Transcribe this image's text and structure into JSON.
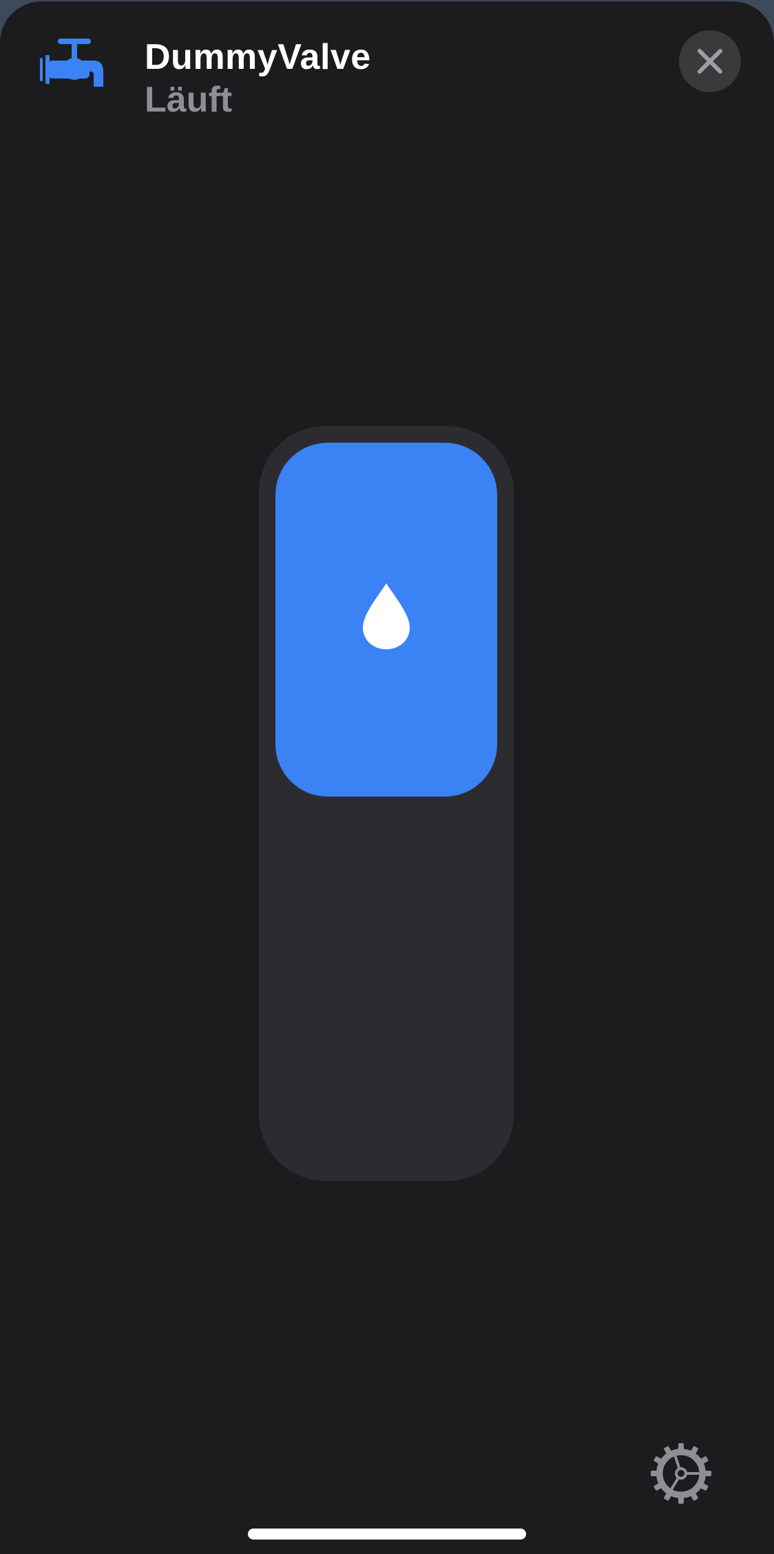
{
  "accessory": {
    "name": "DummyValve",
    "status": "Läuft",
    "icon": "faucet-icon",
    "accent_color": "#3b82f5"
  },
  "controls": {
    "close_icon": "close-icon",
    "settings_icon": "gear-icon",
    "valve_toggle": {
      "state": "on",
      "icon": "water-drop-icon",
      "fill_color": "#3b82f5",
      "track_color": "#2c2c30"
    }
  }
}
